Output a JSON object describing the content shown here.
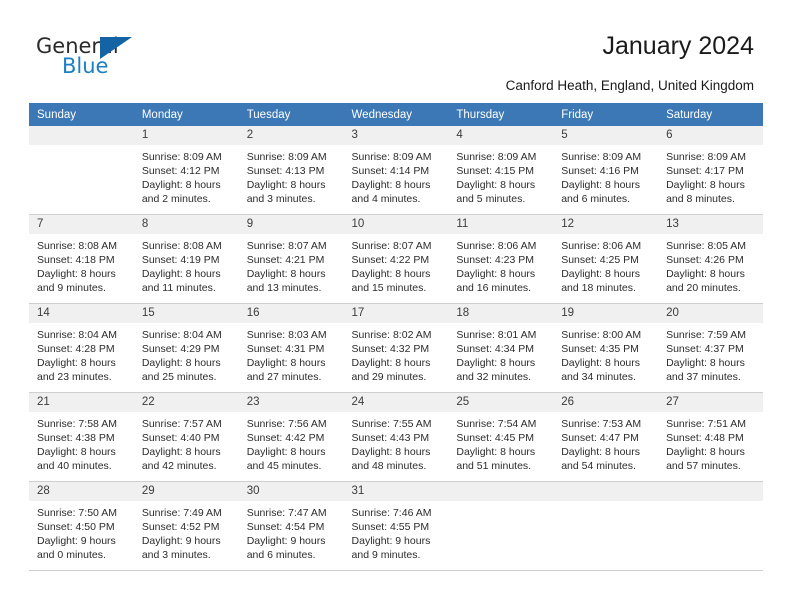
{
  "brand": {
    "name_top": "General",
    "name_bottom": "Blue",
    "accent_color": "#1c7fc4",
    "triangle_color": "#1464a5"
  },
  "header": {
    "title": "January 2024",
    "subtitle": "Canford Heath, England, United Kingdom"
  },
  "calendar": {
    "header_bg": "#3b78b5",
    "daynum_band_bg": "#f0f0f0",
    "columns": [
      "Sunday",
      "Monday",
      "Tuesday",
      "Wednesday",
      "Thursday",
      "Friday",
      "Saturday"
    ],
    "weeks": [
      [
        {
          "day": "",
          "sunrise": "",
          "sunset": "",
          "daylight_1": "",
          "daylight_2": ""
        },
        {
          "day": "1",
          "sunrise": "Sunrise: 8:09 AM",
          "sunset": "Sunset: 4:12 PM",
          "daylight_1": "Daylight: 8 hours",
          "daylight_2": "and 2 minutes."
        },
        {
          "day": "2",
          "sunrise": "Sunrise: 8:09 AM",
          "sunset": "Sunset: 4:13 PM",
          "daylight_1": "Daylight: 8 hours",
          "daylight_2": "and 3 minutes."
        },
        {
          "day": "3",
          "sunrise": "Sunrise: 8:09 AM",
          "sunset": "Sunset: 4:14 PM",
          "daylight_1": "Daylight: 8 hours",
          "daylight_2": "and 4 minutes."
        },
        {
          "day": "4",
          "sunrise": "Sunrise: 8:09 AM",
          "sunset": "Sunset: 4:15 PM",
          "daylight_1": "Daylight: 8 hours",
          "daylight_2": "and 5 minutes."
        },
        {
          "day": "5",
          "sunrise": "Sunrise: 8:09 AM",
          "sunset": "Sunset: 4:16 PM",
          "daylight_1": "Daylight: 8 hours",
          "daylight_2": "and 6 minutes."
        },
        {
          "day": "6",
          "sunrise": "Sunrise: 8:09 AM",
          "sunset": "Sunset: 4:17 PM",
          "daylight_1": "Daylight: 8 hours",
          "daylight_2": "and 8 minutes."
        }
      ],
      [
        {
          "day": "7",
          "sunrise": "Sunrise: 8:08 AM",
          "sunset": "Sunset: 4:18 PM",
          "daylight_1": "Daylight: 8 hours",
          "daylight_2": "and 9 minutes."
        },
        {
          "day": "8",
          "sunrise": "Sunrise: 8:08 AM",
          "sunset": "Sunset: 4:19 PM",
          "daylight_1": "Daylight: 8 hours",
          "daylight_2": "and 11 minutes."
        },
        {
          "day": "9",
          "sunrise": "Sunrise: 8:07 AM",
          "sunset": "Sunset: 4:21 PM",
          "daylight_1": "Daylight: 8 hours",
          "daylight_2": "and 13 minutes."
        },
        {
          "day": "10",
          "sunrise": "Sunrise: 8:07 AM",
          "sunset": "Sunset: 4:22 PM",
          "daylight_1": "Daylight: 8 hours",
          "daylight_2": "and 15 minutes."
        },
        {
          "day": "11",
          "sunrise": "Sunrise: 8:06 AM",
          "sunset": "Sunset: 4:23 PM",
          "daylight_1": "Daylight: 8 hours",
          "daylight_2": "and 16 minutes."
        },
        {
          "day": "12",
          "sunrise": "Sunrise: 8:06 AM",
          "sunset": "Sunset: 4:25 PM",
          "daylight_1": "Daylight: 8 hours",
          "daylight_2": "and 18 minutes."
        },
        {
          "day": "13",
          "sunrise": "Sunrise: 8:05 AM",
          "sunset": "Sunset: 4:26 PM",
          "daylight_1": "Daylight: 8 hours",
          "daylight_2": "and 20 minutes."
        }
      ],
      [
        {
          "day": "14",
          "sunrise": "Sunrise: 8:04 AM",
          "sunset": "Sunset: 4:28 PM",
          "daylight_1": "Daylight: 8 hours",
          "daylight_2": "and 23 minutes."
        },
        {
          "day": "15",
          "sunrise": "Sunrise: 8:04 AM",
          "sunset": "Sunset: 4:29 PM",
          "daylight_1": "Daylight: 8 hours",
          "daylight_2": "and 25 minutes."
        },
        {
          "day": "16",
          "sunrise": "Sunrise: 8:03 AM",
          "sunset": "Sunset: 4:31 PM",
          "daylight_1": "Daylight: 8 hours",
          "daylight_2": "and 27 minutes."
        },
        {
          "day": "17",
          "sunrise": "Sunrise: 8:02 AM",
          "sunset": "Sunset: 4:32 PM",
          "daylight_1": "Daylight: 8 hours",
          "daylight_2": "and 29 minutes."
        },
        {
          "day": "18",
          "sunrise": "Sunrise: 8:01 AM",
          "sunset": "Sunset: 4:34 PM",
          "daylight_1": "Daylight: 8 hours",
          "daylight_2": "and 32 minutes."
        },
        {
          "day": "19",
          "sunrise": "Sunrise: 8:00 AM",
          "sunset": "Sunset: 4:35 PM",
          "daylight_1": "Daylight: 8 hours",
          "daylight_2": "and 34 minutes."
        },
        {
          "day": "20",
          "sunrise": "Sunrise: 7:59 AM",
          "sunset": "Sunset: 4:37 PM",
          "daylight_1": "Daylight: 8 hours",
          "daylight_2": "and 37 minutes."
        }
      ],
      [
        {
          "day": "21",
          "sunrise": "Sunrise: 7:58 AM",
          "sunset": "Sunset: 4:38 PM",
          "daylight_1": "Daylight: 8 hours",
          "daylight_2": "and 40 minutes."
        },
        {
          "day": "22",
          "sunrise": "Sunrise: 7:57 AM",
          "sunset": "Sunset: 4:40 PM",
          "daylight_1": "Daylight: 8 hours",
          "daylight_2": "and 42 minutes."
        },
        {
          "day": "23",
          "sunrise": "Sunrise: 7:56 AM",
          "sunset": "Sunset: 4:42 PM",
          "daylight_1": "Daylight: 8 hours",
          "daylight_2": "and 45 minutes."
        },
        {
          "day": "24",
          "sunrise": "Sunrise: 7:55 AM",
          "sunset": "Sunset: 4:43 PM",
          "daylight_1": "Daylight: 8 hours",
          "daylight_2": "and 48 minutes."
        },
        {
          "day": "25",
          "sunrise": "Sunrise: 7:54 AM",
          "sunset": "Sunset: 4:45 PM",
          "daylight_1": "Daylight: 8 hours",
          "daylight_2": "and 51 minutes."
        },
        {
          "day": "26",
          "sunrise": "Sunrise: 7:53 AM",
          "sunset": "Sunset: 4:47 PM",
          "daylight_1": "Daylight: 8 hours",
          "daylight_2": "and 54 minutes."
        },
        {
          "day": "27",
          "sunrise": "Sunrise: 7:51 AM",
          "sunset": "Sunset: 4:48 PM",
          "daylight_1": "Daylight: 8 hours",
          "daylight_2": "and 57 minutes."
        }
      ],
      [
        {
          "day": "28",
          "sunrise": "Sunrise: 7:50 AM",
          "sunset": "Sunset: 4:50 PM",
          "daylight_1": "Daylight: 9 hours",
          "daylight_2": "and 0 minutes."
        },
        {
          "day": "29",
          "sunrise": "Sunrise: 7:49 AM",
          "sunset": "Sunset: 4:52 PM",
          "daylight_1": "Daylight: 9 hours",
          "daylight_2": "and 3 minutes."
        },
        {
          "day": "30",
          "sunrise": "Sunrise: 7:47 AM",
          "sunset": "Sunset: 4:54 PM",
          "daylight_1": "Daylight: 9 hours",
          "daylight_2": "and 6 minutes."
        },
        {
          "day": "31",
          "sunrise": "Sunrise: 7:46 AM",
          "sunset": "Sunset: 4:55 PM",
          "daylight_1": "Daylight: 9 hours",
          "daylight_2": "and 9 minutes."
        },
        {
          "day": "",
          "sunrise": "",
          "sunset": "",
          "daylight_1": "",
          "daylight_2": ""
        },
        {
          "day": "",
          "sunrise": "",
          "sunset": "",
          "daylight_1": "",
          "daylight_2": ""
        },
        {
          "day": "",
          "sunrise": "",
          "sunset": "",
          "daylight_1": "",
          "daylight_2": ""
        }
      ]
    ]
  }
}
